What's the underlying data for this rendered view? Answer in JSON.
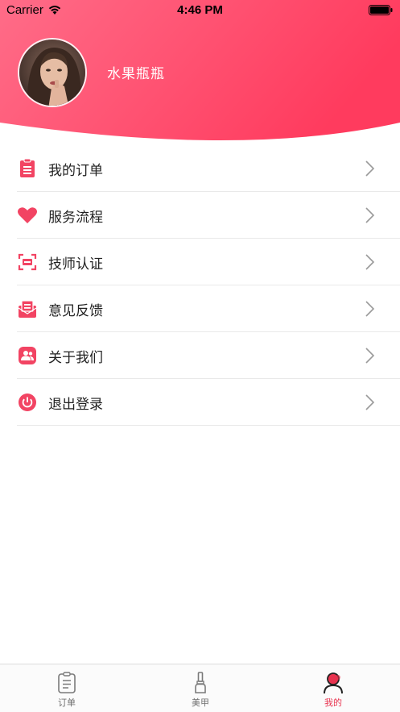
{
  "status_bar": {
    "carrier": "Carrier",
    "time": "4:46 PM"
  },
  "profile": {
    "username": "水果瓶瓶"
  },
  "menu": {
    "items": [
      {
        "label": "我的订单",
        "icon": "clipboard-icon"
      },
      {
        "label": "服务流程",
        "icon": "heart-icon"
      },
      {
        "label": "技师认证",
        "icon": "scan-id-icon"
      },
      {
        "label": "意见反馈",
        "icon": "feedback-mail-icon"
      },
      {
        "label": "关于我们",
        "icon": "about-us-icon"
      },
      {
        "label": "退出登录",
        "icon": "power-icon"
      }
    ]
  },
  "tabbar": {
    "tabs": [
      {
        "label": "订单",
        "icon": "clipboard-icon",
        "active": false
      },
      {
        "label": "美甲",
        "icon": "nail-polish-icon",
        "active": false
      },
      {
        "label": "我的",
        "icon": "person-icon",
        "active": true
      }
    ]
  },
  "colors": {
    "header_gradient_start": "#ff6a86",
    "header_gradient_end": "#ff3d5f",
    "accent": "#e8334f",
    "icon_pink": "#f24463",
    "text_primary": "#222222",
    "tab_inactive": "#6f6f6f"
  }
}
